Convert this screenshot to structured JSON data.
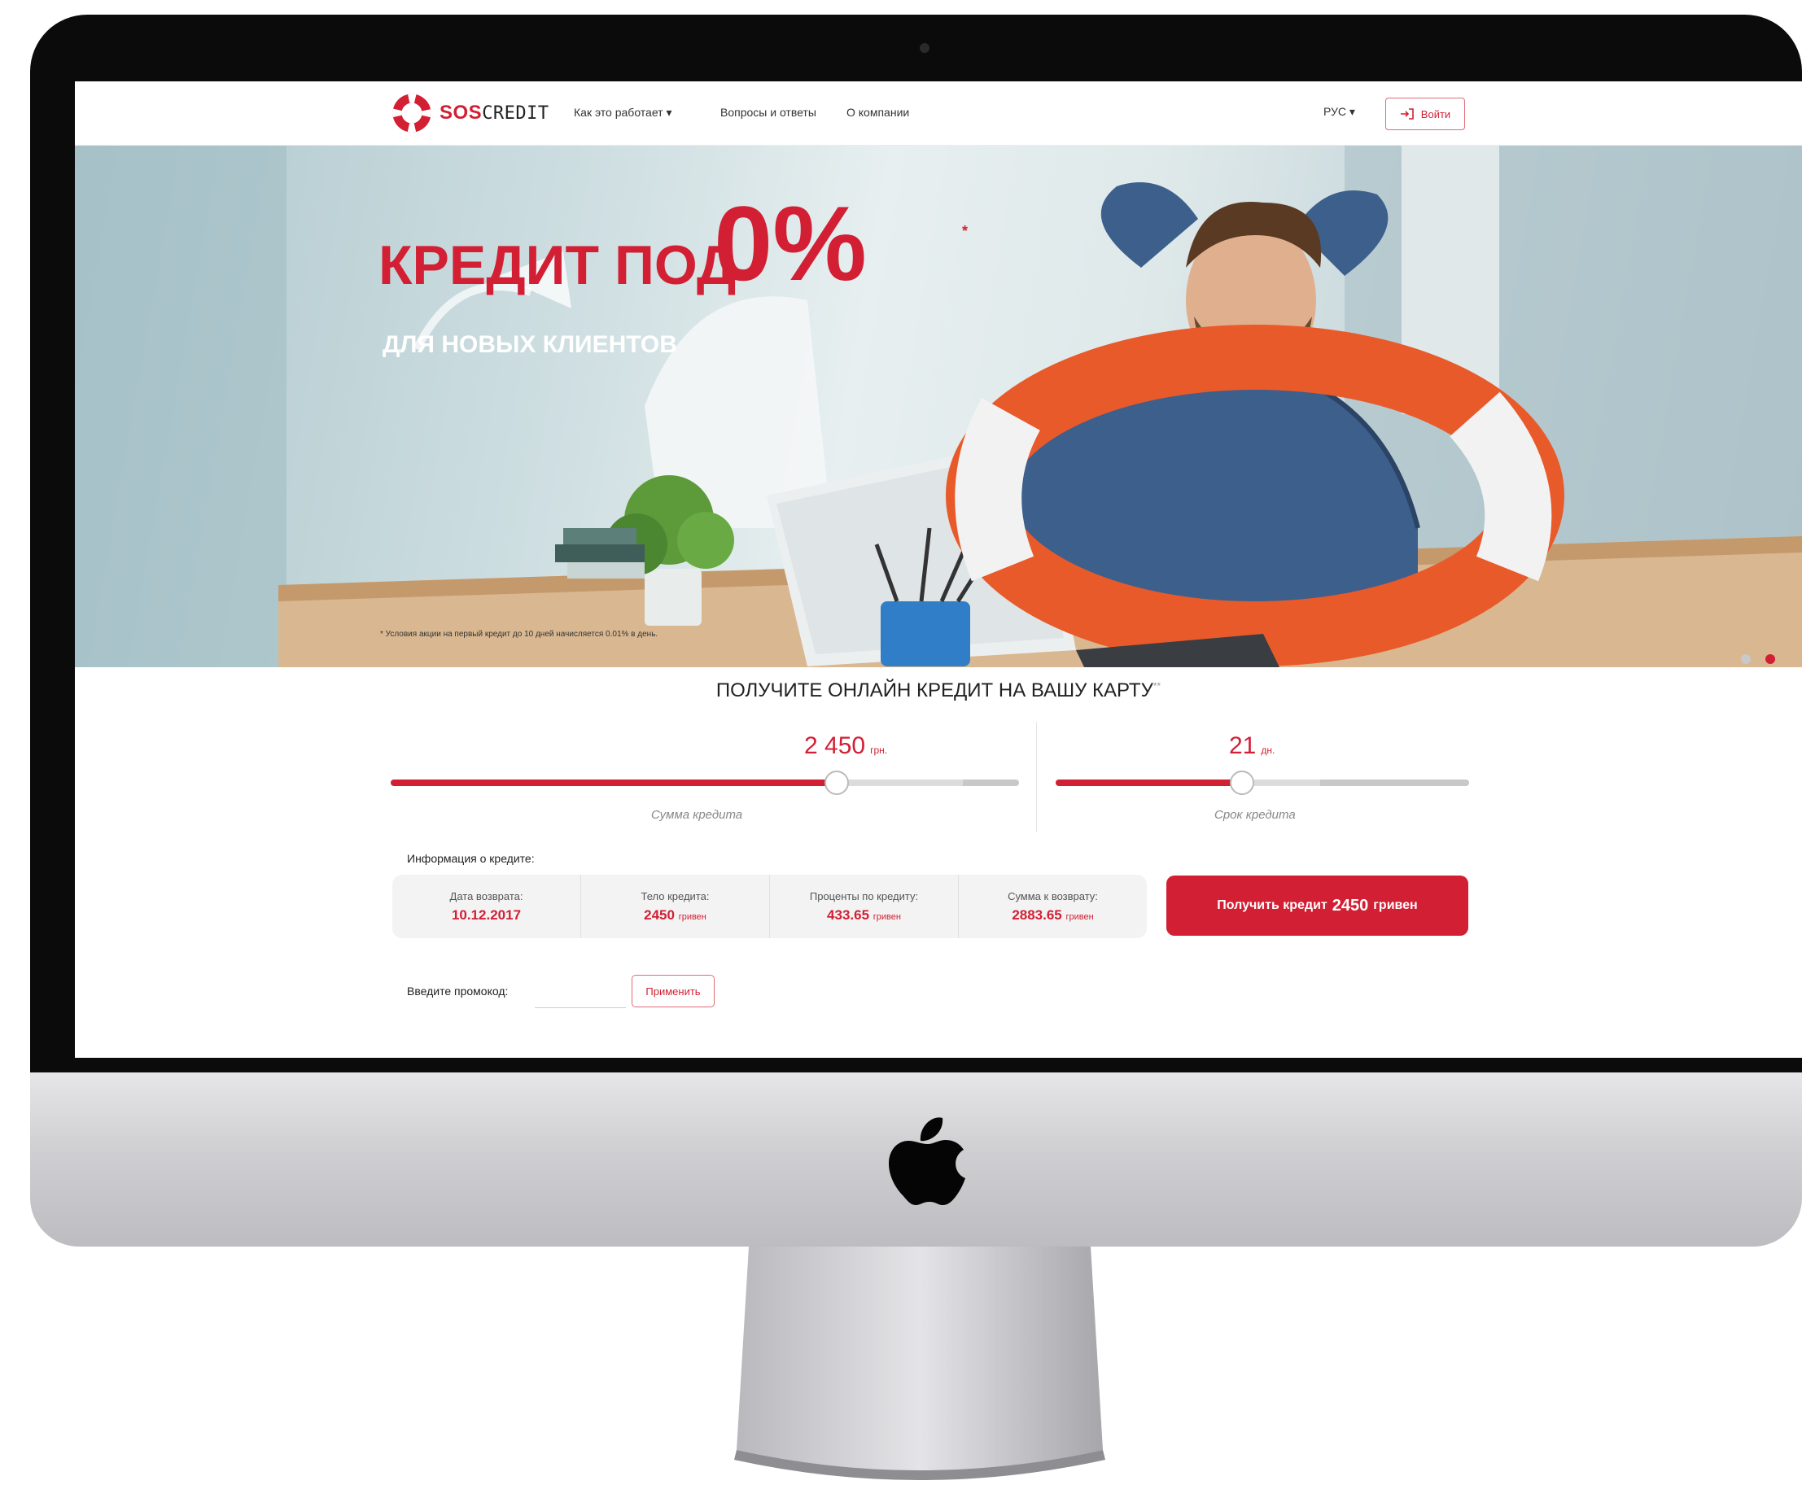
{
  "brand": {
    "sos": "SOS",
    "credit": "CREDIT"
  },
  "nav": {
    "items": [
      {
        "label": "Как это работает ▾"
      },
      {
        "label": "Вопросы и ответы"
      },
      {
        "label": "О компании"
      }
    ],
    "language": "РУС ▾",
    "login_label": "Войти"
  },
  "hero": {
    "title": "КРЕДИТ ПОД",
    "percent": "0%",
    "percent_mark": "*",
    "subtitle": "ДЛЯ НОВЫХ КЛИЕНТОВ",
    "footnote": "* Условия акции на первый кредит до 10 дней начисляется 0.01% в день.",
    "slides_total": 2,
    "active_slide": 2
  },
  "calculator": {
    "title": "ПОЛУЧИТЕ ОНЛАЙН КРЕДИТ НА ВАШУ КАРТУ",
    "title_mark": "**",
    "amount": {
      "value": "2 450",
      "unit": "грн.",
      "label": "Сумма кредита",
      "position": 0.71,
      "track_end": 0.91
    },
    "term": {
      "value": "21",
      "unit": "дн.",
      "label": "Срок кредита",
      "position": 0.45,
      "track_end": 0.64
    },
    "info_title": "Информация о кредите:",
    "info": [
      {
        "label": "Дата возврата:",
        "value": "10.12.2017",
        "unit": ""
      },
      {
        "label": "Тело кредита:",
        "value": "2450",
        "unit": "гривен"
      },
      {
        "label": "Проценты по кредиту:",
        "value": "433.65",
        "unit": "гривен"
      },
      {
        "label": "Сумма к возврату:",
        "value": "2883.65",
        "unit": "гривен"
      }
    ],
    "cta": {
      "prefix": "Получить кредит",
      "amount": "2450",
      "suffix": "гривен"
    },
    "promo_label": "Введите промокод:",
    "promo_value": "",
    "promo_button": "Применить"
  },
  "colors": {
    "accent": "#d21f33",
    "bezel": "#0b0b0c",
    "chin": "#cfcfd2"
  }
}
